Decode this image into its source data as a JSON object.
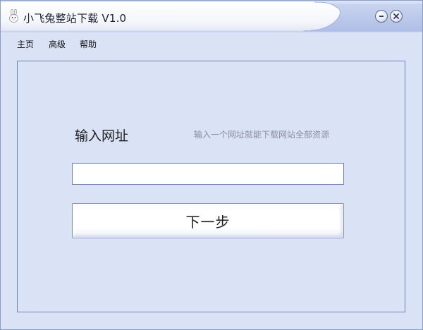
{
  "window": {
    "title": "小飞兔整站下载 V1.0"
  },
  "menu": {
    "items": [
      {
        "label": "主页"
      },
      {
        "label": "高级"
      },
      {
        "label": "帮助"
      }
    ]
  },
  "main": {
    "url_label": "输入网址",
    "url_hint": "输入一个网址就能下载网站全部资源",
    "url_input": {
      "value": "",
      "placeholder": ""
    },
    "next_button_label": "下一步"
  },
  "icons": {
    "app": "rabbit-icon",
    "minimize": "minimize-icon",
    "close": "close-icon"
  },
  "colors": {
    "window_bg": "#dae3f6",
    "titlebar_tab": "#ffffff",
    "panel_border": "#6f82b4",
    "hint_text": "#8a8f9c"
  }
}
